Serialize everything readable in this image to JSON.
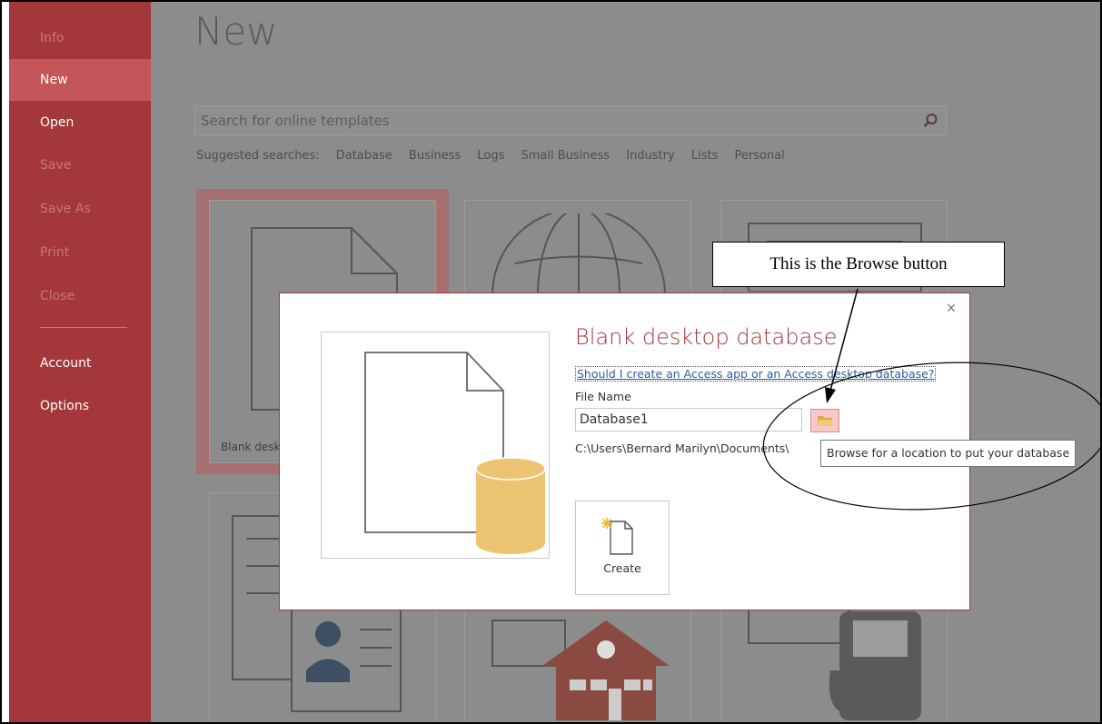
{
  "sidebar": {
    "items": [
      {
        "label": "Info",
        "state": "disabled"
      },
      {
        "label": "New",
        "state": "selected"
      },
      {
        "label": "Open",
        "state": "enabled"
      },
      {
        "label": "Save",
        "state": "disabled"
      },
      {
        "label": "Save As",
        "state": "disabled"
      },
      {
        "label": "Print",
        "state": "disabled"
      },
      {
        "label": "Close",
        "state": "disabled"
      },
      {
        "label": "Account",
        "state": "enabled"
      },
      {
        "label": "Options",
        "state": "enabled"
      }
    ]
  },
  "main": {
    "title": "New",
    "search_placeholder": "Search for online templates",
    "suggested_label": "Suggested searches:",
    "suggested": [
      "Database",
      "Business",
      "Logs",
      "Small Business",
      "Industry",
      "Lists",
      "Personal"
    ],
    "tile_blank_label": "Blank deskto"
  },
  "dialog": {
    "title": "Blank desktop database",
    "help_link": "Should I create an Access app or an Access desktop database?",
    "file_name_label": "File Name",
    "file_name_value": "Database1",
    "path": "C:\\Users\\Bernard Marilyn\\Documents\\",
    "create_label": "Create",
    "close_glyph": "×"
  },
  "tooltip": {
    "text": "Browse for a location to put your database"
  },
  "annotation": {
    "text": "This is the Browse button"
  },
  "colors": {
    "accent": "#a4373a",
    "link": "#2f5e9e",
    "db_cylinder": "#ecc471"
  }
}
